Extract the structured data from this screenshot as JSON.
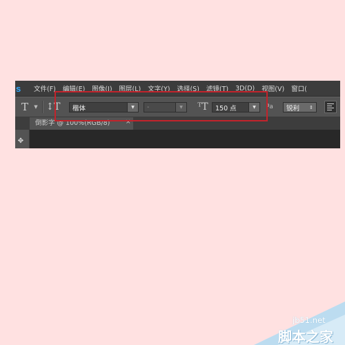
{
  "app": {
    "logo": "s"
  },
  "menubar": {
    "items": [
      {
        "label": "文件(F)"
      },
      {
        "label": "编辑(E)"
      },
      {
        "label": "图像(I)"
      },
      {
        "label": "图层(L)"
      },
      {
        "label": "文字(Y)"
      },
      {
        "label": "选择(S)"
      },
      {
        "label": "滤镜(T)"
      },
      {
        "label": "3D(D)"
      },
      {
        "label": "视图(V)"
      },
      {
        "label": "窗口("
      }
    ]
  },
  "options": {
    "tool_icon": "type-tool-icon",
    "font_family": "楷体",
    "font_style": "-",
    "font_size": "150 点",
    "antialias_glyph": "ªa",
    "antialias": "锐利",
    "alignment": "align-left"
  },
  "document": {
    "tab_title": "倒影字 @ 100%(RGB/8)",
    "tab_close": "×"
  },
  "watermark": {
    "url": "jb51.net",
    "brand": "脚本之家"
  },
  "colors": {
    "background": "#ffe1e1",
    "highlight": "#c3232b",
    "ps_blue": "#31a8ff"
  }
}
